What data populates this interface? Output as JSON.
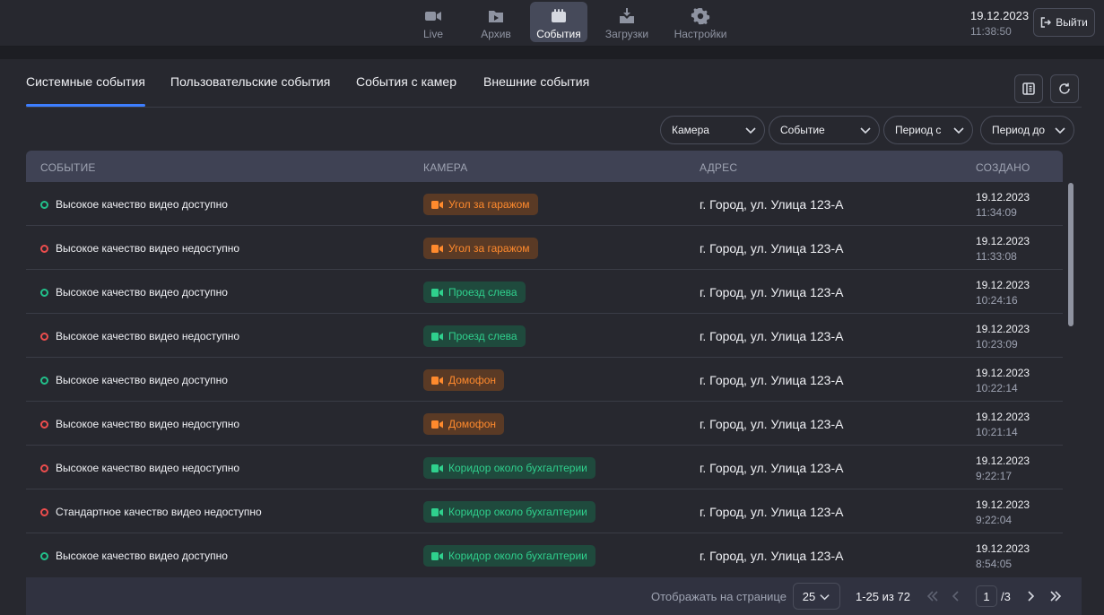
{
  "nav": [
    {
      "label": "Live",
      "icon": "camera-icon"
    },
    {
      "label": "Архив",
      "icon": "archive-play-icon"
    },
    {
      "label": "События",
      "icon": "events-icon"
    },
    {
      "label": "Загрузки",
      "icon": "download-icon"
    },
    {
      "label": "Настройки",
      "icon": "gear-icon"
    }
  ],
  "clock": {
    "date": "19.12.2023",
    "time": "11:38:50"
  },
  "logout_label": "Выйти",
  "tabs": [
    "Системные события",
    "Пользовательские события",
    "События с камер",
    "Внешние события"
  ],
  "filters": {
    "camera": "Камера",
    "event": "Событие",
    "period_from": "Период с",
    "period_to": "Период до"
  },
  "table": {
    "headers": {
      "event": "СОБЫТИЕ",
      "camera": "КАМЕРА",
      "address": "АДРЕС",
      "created": "СОЗДАНО"
    },
    "rows": [
      {
        "status": "ok",
        "event": "Высокое качество видео доступно",
        "camera": "Угол за гаражом",
        "camera_color": "orange",
        "address": "г. Город, ул. Улица 123-А",
        "date": "19.12.2023",
        "time": "11:34:09"
      },
      {
        "status": "bad",
        "event": "Высокое качество видео недоступно",
        "camera": "Угол за гаражом",
        "camera_color": "orange",
        "address": "г. Город, ул. Улица 123-А",
        "date": "19.12.2023",
        "time": "11:33:08"
      },
      {
        "status": "ok",
        "event": "Высокое качество видео доступно",
        "camera": "Проезд слева",
        "camera_color": "green",
        "address": "г. Город, ул. Улица 123-А",
        "date": "19.12.2023",
        "time": "10:24:16"
      },
      {
        "status": "bad",
        "event": "Высокое качество видео недоступно",
        "camera": "Проезд слева",
        "camera_color": "green",
        "address": "г. Город, ул. Улица 123-А",
        "date": "19.12.2023",
        "time": "10:23:09"
      },
      {
        "status": "ok",
        "event": "Высокое качество видео доступно",
        "camera": "Домофон",
        "camera_color": "orange",
        "address": "г. Город, ул. Улица 123-А",
        "date": "19.12.2023",
        "time": "10:22:14"
      },
      {
        "status": "bad",
        "event": "Высокое качество видео недоступно",
        "camera": "Домофон",
        "camera_color": "orange",
        "address": "г. Город, ул. Улица 123-А",
        "date": "19.12.2023",
        "time": "10:21:14"
      },
      {
        "status": "bad",
        "event": "Высокое качество видео недоступно",
        "camera": "Коридор около бухгалтерии",
        "camera_color": "green",
        "address": "г. Город, ул. Улица 123-А",
        "date": "19.12.2023",
        "time": "9:22:17"
      },
      {
        "status": "bad",
        "event": "Стандартное качество видео недоступно",
        "camera": "Коридор около бухгалтерии",
        "camera_color": "green",
        "address": "г. Город, ул. Улица 123-А",
        "date": "19.12.2023",
        "time": "9:22:04"
      },
      {
        "status": "ok",
        "event": "Высокое качество видео доступно",
        "camera": "Коридор около бухгалтерии",
        "camera_color": "green",
        "address": "г. Город, ул. Улица 123-А",
        "date": "19.12.2023",
        "time": "8:54:05"
      }
    ]
  },
  "pagination": {
    "per_page_label": "Отображать на странице",
    "per_page": "25",
    "range": "1-25 из 72",
    "page": "1",
    "total": "/3"
  },
  "colors": {
    "accent": "#3d7eff",
    "ok": "#22c08a",
    "bad": "#ec4d4d",
    "orange": "#ff8a2d",
    "green": "#2fd08d"
  }
}
